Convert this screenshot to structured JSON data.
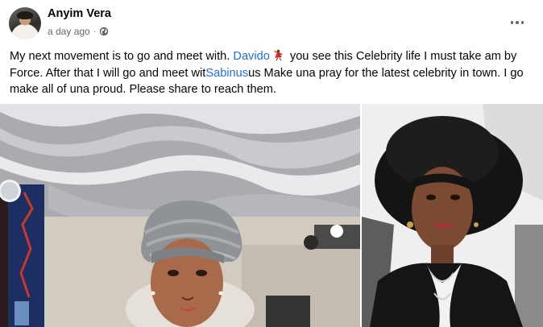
{
  "post": {
    "author_name": "Anyim Vera",
    "timestamp": "a day ago",
    "separator": "·",
    "privacy_icon": "globe-icon",
    "more_icon": "more-options-icon",
    "text": {
      "part1": "My next movement is to go and meet with. ",
      "mention1": "Davido",
      "emoji": "dancer-emoji",
      "part2": " you see this Celebrity life I must take am by Force. After that I will go and meet wit",
      "mention2": "Sabinus",
      "part3": "us Make una pray for the latest celebrity in town. I go make all of una proud. Please share to reach them."
    },
    "photos": [
      {
        "name": "woman-in-grey-headwrap-photo"
      },
      {
        "name": "woman-in-black-hat-photo"
      }
    ]
  },
  "colors": {
    "link": "#216fdb",
    "meta": "#65676b",
    "text": "#050505"
  }
}
